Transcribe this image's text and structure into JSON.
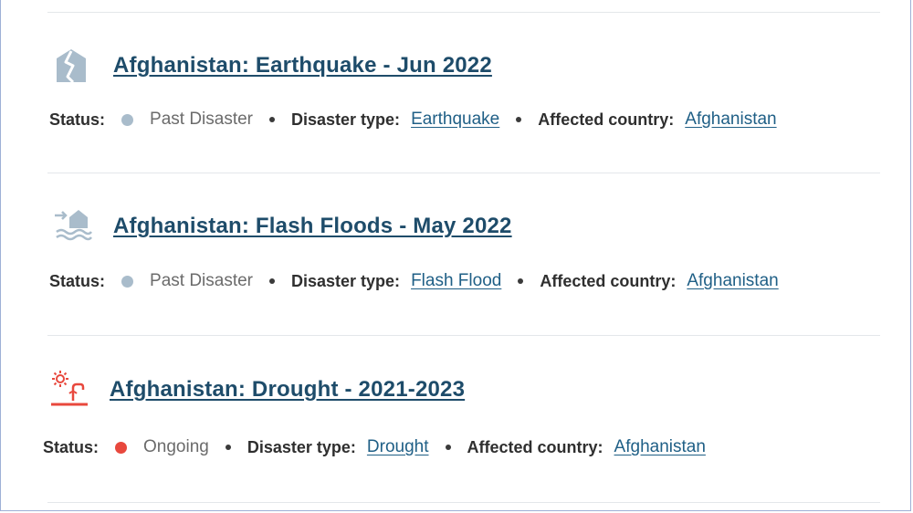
{
  "labels": {
    "status": "Status:",
    "disaster_type": "Disaster type:",
    "affected_country": "Affected country:"
  },
  "items": [
    {
      "icon": "earthquake-icon",
      "title": "Afghanistan: Earthquake - Jun 2022",
      "status": "Past Disaster",
      "status_color": "#a9bccb",
      "disaster_type": "Earthquake",
      "country": "Afghanistan"
    },
    {
      "icon": "flash-flood-icon",
      "title": "Afghanistan: Flash Floods - May 2022",
      "status": "Past Disaster",
      "status_color": "#a9bccb",
      "disaster_type": "Flash Flood",
      "country": "Afghanistan"
    },
    {
      "icon": "drought-icon",
      "title": "Afghanistan: Drought - 2021-2023",
      "status": "Ongoing",
      "status_color": "#e8483d",
      "disaster_type": "Drought",
      "country": "Afghanistan"
    }
  ],
  "colors": {
    "title": "#1e4c6a",
    "link": "#1f5f86",
    "past_icon": "#a9bccb",
    "ongoing_icon": "#e8483d"
  }
}
